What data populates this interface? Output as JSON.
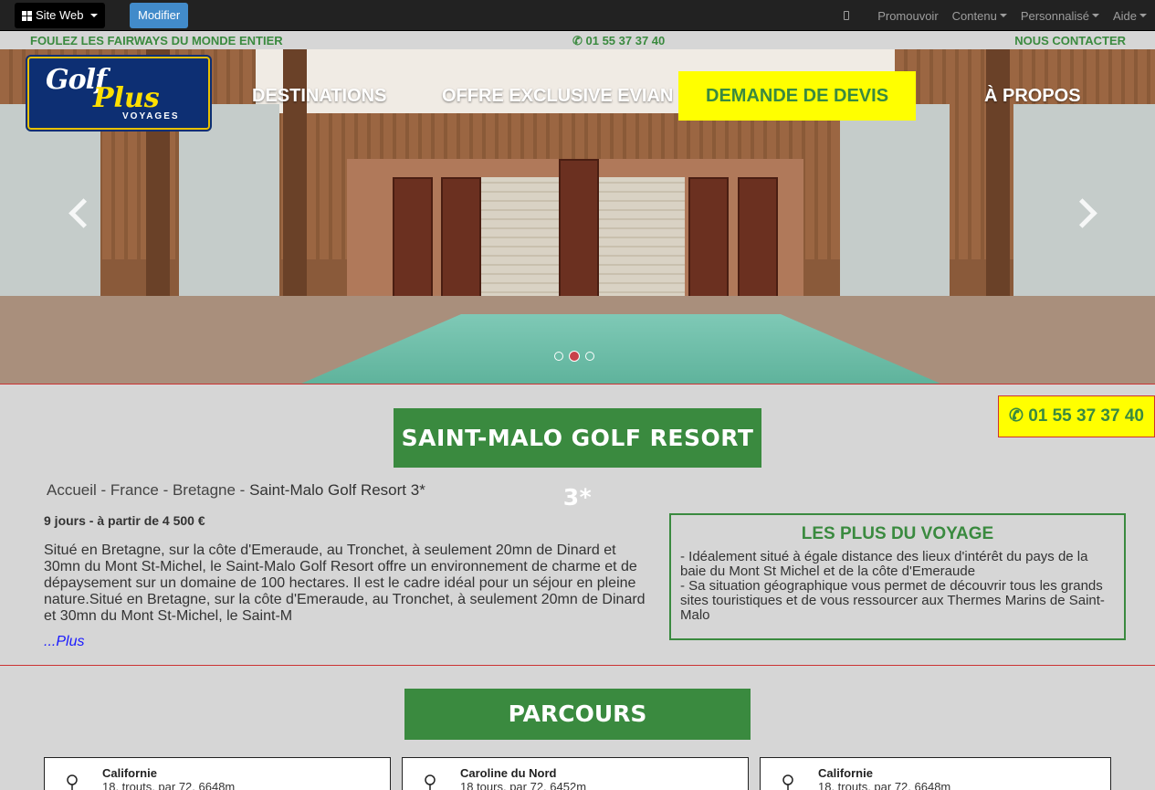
{
  "adminbar": {
    "site_web": "Site Web",
    "modifier": "Modifier",
    "menu": [
      "Promouvoir",
      "Contenu",
      "Personnalisé",
      "Aide"
    ]
  },
  "topstrip": {
    "left": "FOULEZ LES FAIRWAYS DU MONDE ENTIER",
    "phone": "✆ 01 55 37 37 40",
    "right": "NOUS CONTACTER"
  },
  "logo": {
    "line1": "Golf",
    "line2": "Plus",
    "line3": "VOYAGES"
  },
  "nav": {
    "items": [
      "DESTINATIONS",
      "OFFRE EXCLUSIVE EVIAN",
      "DEMANDE DE DEVIS",
      "À PROPOS"
    ]
  },
  "carousel": {
    "slide_count": 3,
    "active_index": 1
  },
  "phone_box": "✆ 01 55 37 37 40",
  "page": {
    "title": "SAINT-MALO GOLF RESORT 3*",
    "breadcrumb": [
      "Accueil",
      "France",
      "Bretagne",
      "Saint-Malo Golf Resort 3*"
    ],
    "breadcrumb_sep": " - ",
    "price": "9 jours - à partir de 4 500 €",
    "description": "Situé en Bretagne, sur la côte d'Emeraude, au Tronchet, à seulement 20mn de Dinard et 30mn du Mont St-Michel, le Saint-Malo Golf Resort offre un environnement de charme et de dépaysement sur un domaine de 100 hectares. Il est le cadre idéal pour un séjour en pleine nature.Situé en Bretagne, sur la côte d'Emeraude, au Tronchet, à seulement 20mn de Dinard et 30mn du Mont St-Michel, le Saint-M",
    "more": "...Plus"
  },
  "plus": {
    "title": "LES PLUS DU VOYAGE",
    "lines": [
      "- Idéalement situé à égale distance des lieux d'intérêt du pays de la baie du Mont St Michel et de la côte d'Emeraude",
      "- Sa situation géographique vous permet de découvrir tous les grands sites touristiques et de vous ressourcer aux Thermes Marins de Saint-Malo"
    ]
  },
  "parcours": {
    "title": "PARCOURS",
    "cards": [
      {
        "name": "Californie",
        "info": "18, trouts, par 72, 6648m"
      },
      {
        "name": "Caroline du Nord",
        "info": "18 tours, par 72, 6452m"
      },
      {
        "name": "Californie",
        "info": "18, trouts, par 72, 6648m"
      }
    ]
  },
  "colors": {
    "green": "#3a8a3f",
    "yellow": "#ffff00",
    "admin_bar": "#222222",
    "modifier_blue": "#428bca",
    "link_blue": "#1a1aff",
    "red_line": "#cc3333"
  }
}
